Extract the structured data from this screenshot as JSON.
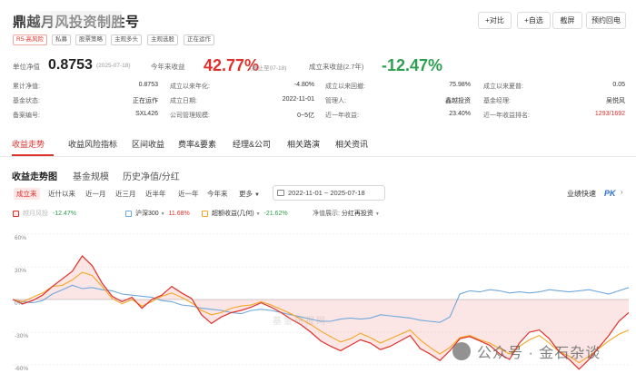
{
  "header": {
    "fund_name": "鼎越月风投资制胜号",
    "buttons": [
      "+对比",
      "+自选",
      "截屏",
      "预约回电"
    ]
  },
  "tags": [
    "R5-高风险",
    "私募",
    "股票策略",
    "主观多头",
    "主观选股",
    "正在运作"
  ],
  "summary": {
    "nav_label": "单位净值",
    "nav_value": "0.8753",
    "nav_date": "(2025-07-18)",
    "ytd_label": "今年来收益",
    "ytd_value": "42.77%",
    "ytd_note": "(截止至07-18)",
    "since_label": "成立来收益(2.7年)",
    "since_value": "-12.47%"
  },
  "details": {
    "col1": [
      {
        "label": "累计净值:",
        "value": "0.8753"
      },
      {
        "label": "基金状态:",
        "value": "正在运作"
      },
      {
        "label": "备案编号:",
        "value": "SXL426"
      }
    ],
    "col2": [
      {
        "label": "成立以来年化:",
        "value": "-4.80%"
      },
      {
        "label": "成立日期:",
        "value": "2022-11-01"
      },
      {
        "label": "公司管理规模:",
        "value": "0~5亿"
      }
    ],
    "col3": [
      {
        "label": "成立以来回撤:",
        "value": "75.98%"
      },
      {
        "label": "管理人:",
        "value": "鑫越投资"
      },
      {
        "label": "近一年收益:",
        "value": "23.40%"
      }
    ],
    "col4": [
      {
        "label": "成立以来夏普:",
        "value": "0.05"
      },
      {
        "label": "基金经理:",
        "value": "吴悦风"
      },
      {
        "label": "近一年收益排名:",
        "value": "1293/1692"
      }
    ]
  },
  "tabs": [
    "收益走势",
    "收益风险指标",
    "区间收益",
    "费率&要素",
    "经理&公司",
    "相关路演",
    "相关资讯"
  ],
  "sub_tabs": [
    "收益走势图",
    "基金规模",
    "历史净值/分红"
  ],
  "ranges": [
    "成立来",
    "近什以来",
    "近一月",
    "近三月",
    "近半年",
    "近一年",
    "今年来",
    "更多"
  ],
  "date_range": "2022-11-01 ~ 2025-07-18",
  "pk_label": "业绩快速",
  "pk_mark": "PK",
  "legend": {
    "fund_name": "越月风投",
    "fund_value": "-12.47%",
    "index_name": "沪深300",
    "index_value": "11.68%",
    "peer_name": "超额收益(几何)",
    "peer_value": "-21.62%",
    "nav_display_label": "净值展示:",
    "nav_display_value": "分红再投资"
  },
  "chart_data": {
    "type": "line",
    "y_ticks": [
      "60%",
      "30%",
      "0%",
      "-30%",
      "-60%"
    ],
    "ylim": [
      -75,
      70
    ],
    "series": [
      {
        "name": "越月风投",
        "color": "#e0302b",
        "values": [
          0,
          -4,
          -1,
          4,
          12,
          19,
          26,
          40,
          31,
          15,
          3,
          -2,
          2,
          -8,
          0,
          4,
          12,
          6,
          1,
          -14,
          -22,
          -16,
          -12,
          -10,
          -7,
          -3,
          -7,
          -12,
          -18,
          -23,
          -30,
          -38,
          -43,
          -47,
          -42,
          -37,
          -40,
          -46,
          -43,
          -38,
          -33,
          -45,
          -50,
          -56,
          -47,
          -36,
          -34,
          -38,
          -42,
          -50,
          -55,
          -40,
          -30,
          -28,
          -36,
          -48,
          -55,
          -64,
          -55,
          -44,
          -33,
          -20,
          -12
        ]
      },
      {
        "name": "沪深300",
        "color": "#6fa8dc",
        "values": [
          0,
          -2,
          -3,
          -1,
          5,
          9,
          13,
          10,
          11,
          9,
          8,
          5,
          4,
          3,
          2,
          -1,
          -2,
          -5,
          -6,
          -8,
          -9,
          -10,
          -12,
          -13,
          -10,
          -9,
          -10,
          -12,
          -14,
          -16,
          -18,
          -20,
          -20,
          -18,
          -17,
          -18,
          -17,
          -14,
          -15,
          -16,
          -17,
          -19,
          -20,
          -21,
          -16,
          5,
          8,
          7,
          9,
          8,
          6,
          7,
          6,
          7,
          9,
          8,
          7,
          8,
          9,
          7,
          5,
          8,
          11
        ]
      },
      {
        "name": "超额收益(几何)",
        "color": "#f5a623",
        "values": [
          0,
          -2,
          2,
          6,
          12,
          13,
          18,
          25,
          22,
          12,
          1,
          -4,
          0,
          -6,
          -2,
          3,
          6,
          2,
          -3,
          -10,
          -14,
          -12,
          -8,
          -6,
          -5,
          -2,
          -5,
          -9,
          -13,
          -18,
          -23,
          -29,
          -34,
          -39,
          -36,
          -31,
          -35,
          -40,
          -36,
          -32,
          -28,
          -37,
          -44,
          -50,
          -44,
          -35,
          -33,
          -37,
          -40,
          -45,
          -50,
          -43,
          -37,
          -33,
          -40,
          -48,
          -52,
          -58,
          -52,
          -45,
          -38,
          -32,
          -28
        ]
      }
    ]
  },
  "watermark_mid": "基金研报网",
  "watermark": "公众号 · 金石杂谈"
}
